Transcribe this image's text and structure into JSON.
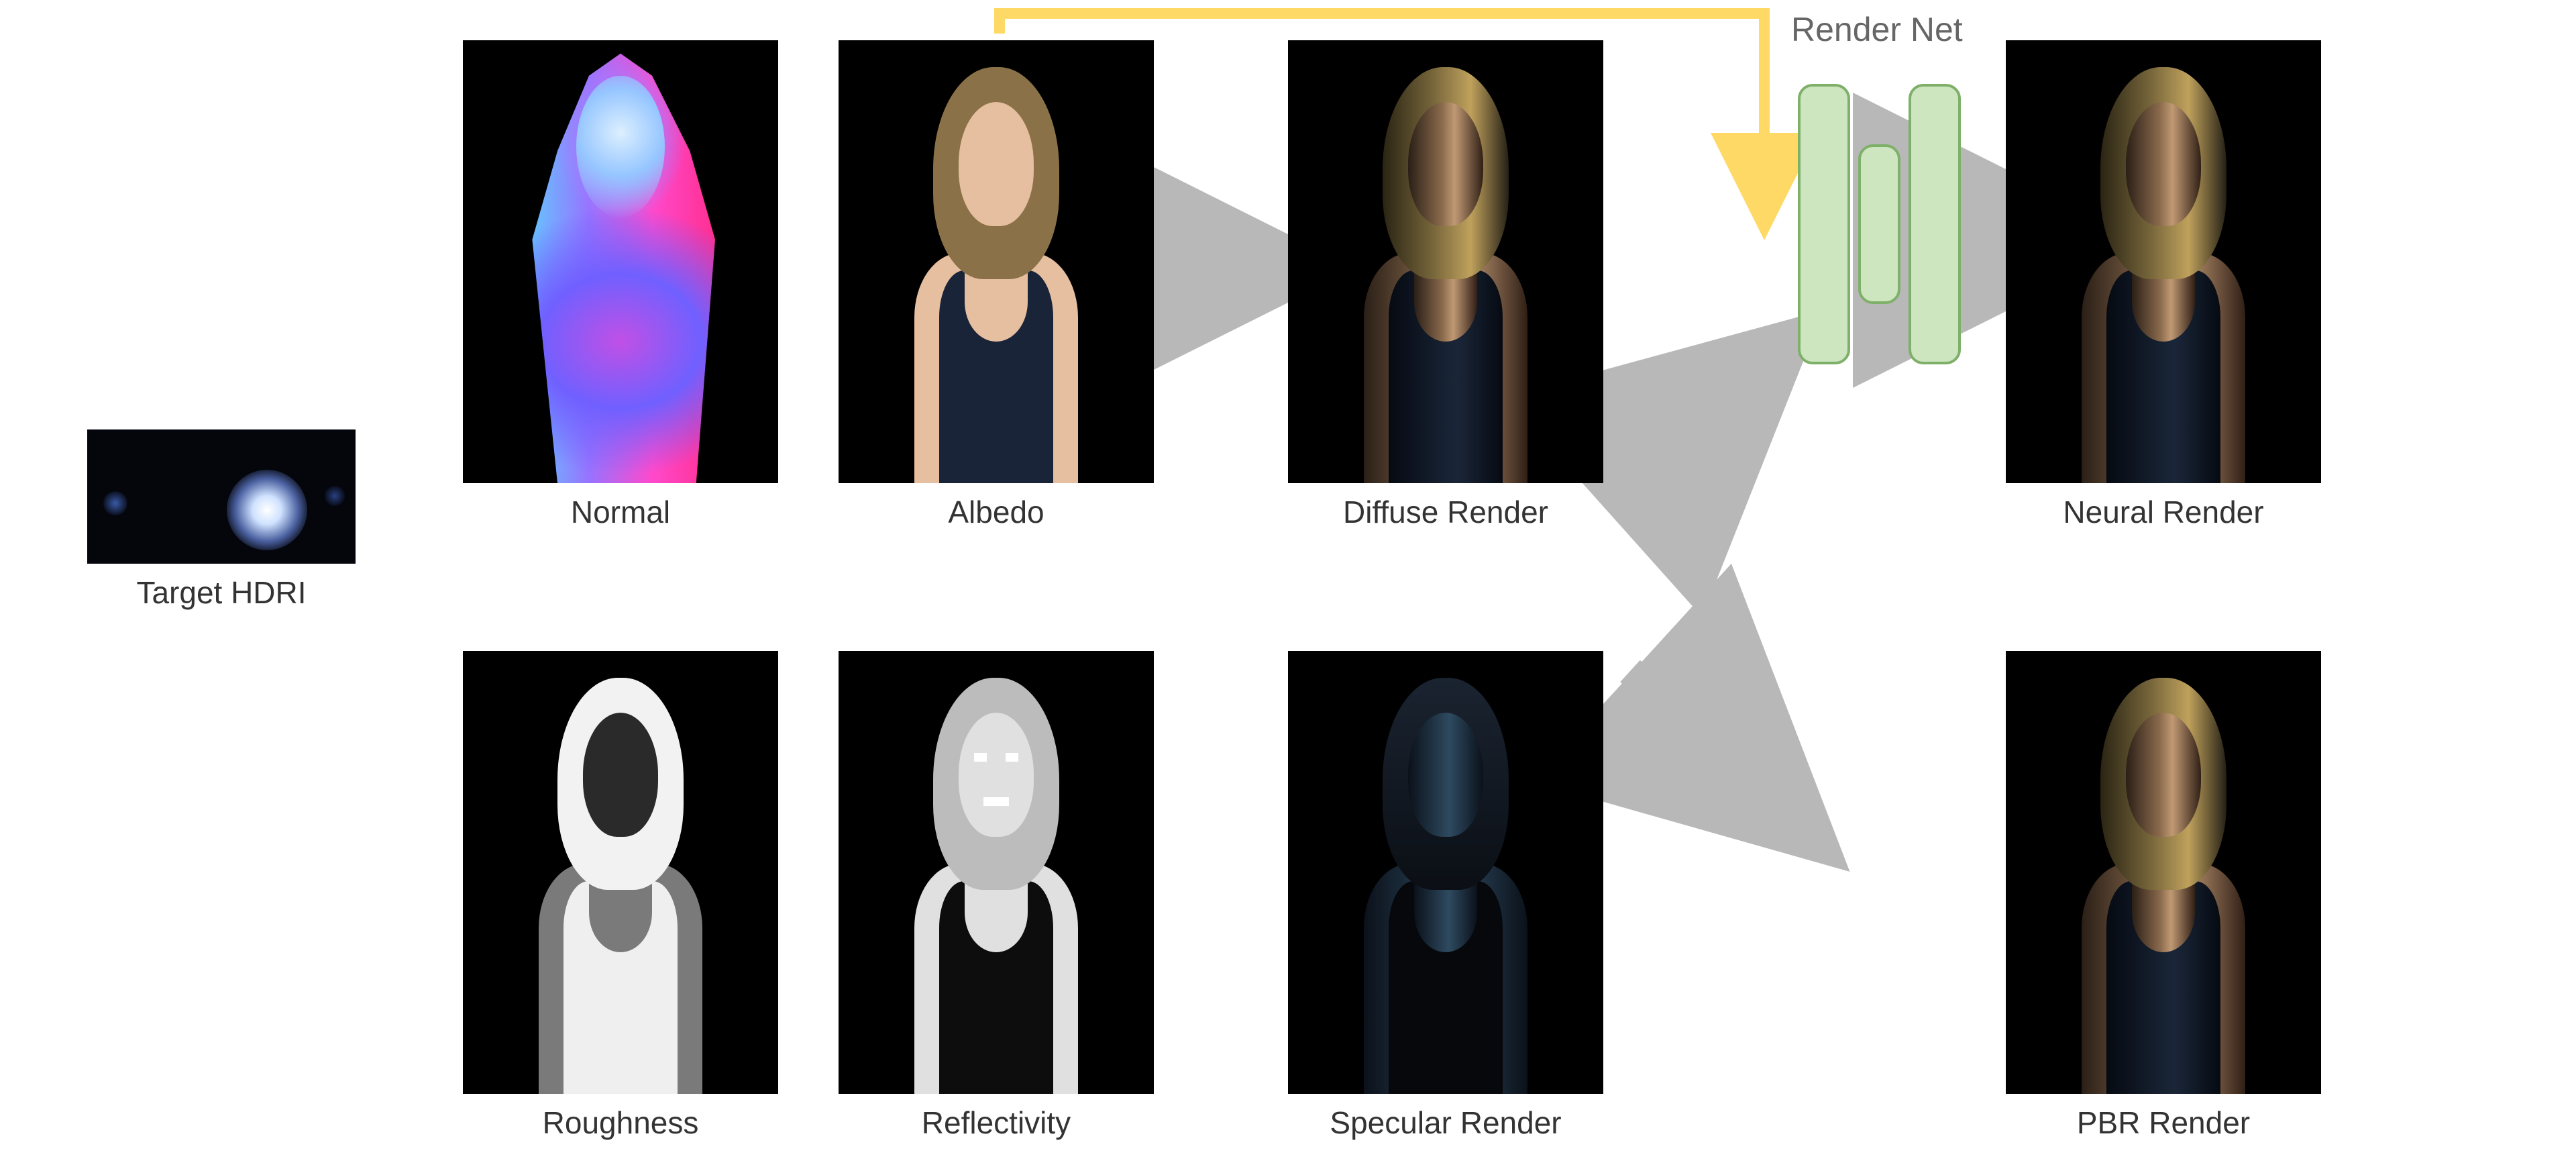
{
  "labels": {
    "hdri": "Target HDRI",
    "normal": "Normal",
    "albedo": "Albedo",
    "diffuse": "Diffuse Render",
    "roughness": "Roughness",
    "reflectivity": "Reflectivity",
    "specular": "Specular Render",
    "neural": "Neural Render",
    "pbr": "PBR Render",
    "render_net": "Render Net"
  },
  "flow": {
    "description": "Target HDRI plus intrinsic maps (Normal, Albedo, Roughness, Reflectivity) combine into Diffuse and Specular renders; Diffuse + Specular feed into Render Net to produce Neural Render, and also sum directly to PBR Render. Albedo is also fed directly to Render Net (yellow connection)."
  },
  "colors": {
    "arrow": "#b8b8b8",
    "gold_arrow": "#ffd966",
    "net_fill": "#cde6c0",
    "net_stroke": "#7fb069"
  }
}
